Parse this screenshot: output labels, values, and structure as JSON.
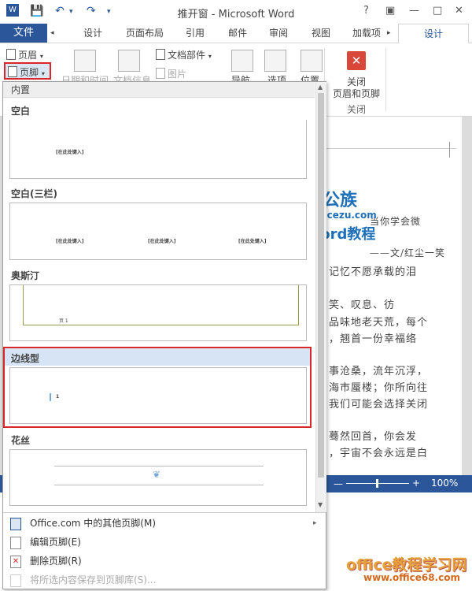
{
  "window": {
    "title": "推开窗 - Microsoft Word",
    "help": "?",
    "minimize": "—",
    "restore": "□",
    "close": "✕"
  },
  "tabs": {
    "file": "文件",
    "items": [
      "设计",
      "页面布局",
      "引用",
      "邮件",
      "审阅",
      "视图",
      "加载项"
    ],
    "active": "设计"
  },
  "ribbon": {
    "header_label": "页眉",
    "footer_label": "页脚",
    "datetime": "日期和时间",
    "docinfo": "文档信息",
    "docparts": "文档部件",
    "picture": "图片",
    "nav": "导航",
    "options": "选项",
    "position": "位置",
    "close_line1": "关闭",
    "close_line2": "页眉和页脚",
    "close_group": "关闭"
  },
  "gallery": {
    "section": "内置",
    "items": [
      {
        "title": "空白",
        "placeholder": "[在此处键入]"
      },
      {
        "title": "空白(三栏)",
        "placeholder": "[在此处键入]"
      },
      {
        "title": "奥斯汀",
        "placeholder": "页 1"
      },
      {
        "title": "边线型",
        "placeholder": "1"
      },
      {
        "title": "花丝",
        "placeholder": ""
      }
    ]
  },
  "menu": {
    "more": "Office.com 中的其他页脚(M)",
    "edit": "编辑页脚(E)",
    "remove": "删除页脚(R)",
    "save": "将所选内容保存到页脚库(S)..."
  },
  "document": {
    "lines": [
      "当你学会微",
      "——文/红尘一笑",
      "记忆不愿承载的泪",
      "笑、叹息、彷",
      "品味地老天荒，每个",
      "，翘首一份幸福络",
      "事沧桑，流年沉浮，",
      "海市蜃楼；你所向往",
      "我们可能会选择关闭",
      "蓦然回首，你会发",
      "，宇宙不会永远是白"
    ]
  },
  "status": {
    "zoom": "100%",
    "minus": "—",
    "plus": "+"
  },
  "watermark": {
    "logo1": "办公族",
    "logo2": "Officezu.com",
    "logo3": "Word教程",
    "site1": "office教程学习网",
    "site2": "www.office68.com"
  },
  "colors": {
    "accent": "#2b579a",
    "highlight": "#d9262b"
  }
}
